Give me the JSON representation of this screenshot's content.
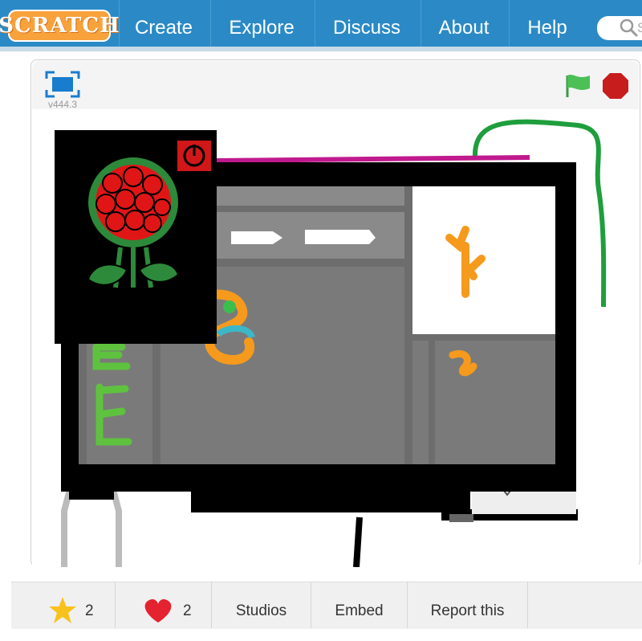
{
  "nav": {
    "logo": "SCRATCH",
    "items": [
      "Create",
      "Explore",
      "Discuss",
      "About",
      "Help"
    ],
    "search_partial": "S"
  },
  "player": {
    "version": "v444.3"
  },
  "stats": {
    "stars": "2",
    "loves": "2",
    "studios": "Studios",
    "embed": "Embed",
    "report": "Report this"
  },
  "colors": {
    "nav_bg": "#2b8ac6",
    "logo_bg": "#f7a23b",
    "flag": "#4cbf56",
    "stop": "#d32121",
    "star": "#f7c21b",
    "heart": "#e5222f"
  }
}
